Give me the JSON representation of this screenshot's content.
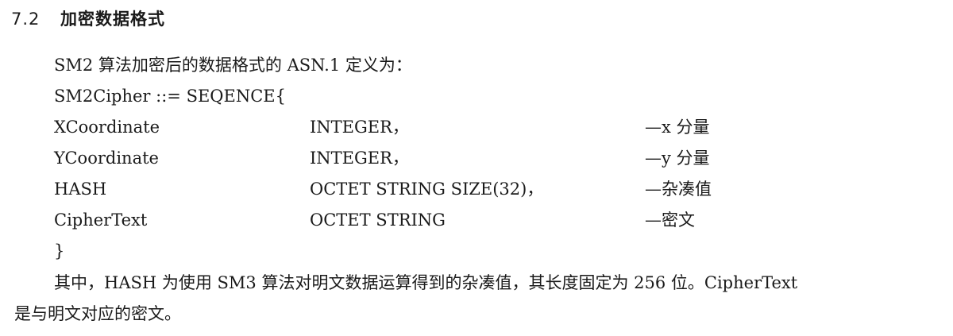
{
  "section": {
    "number": "7.2",
    "title": "加密数据格式"
  },
  "intro": "SM2 算法加密后的数据格式的 ASN.1 定义为：",
  "struct_open": "SM2Cipher ::= SEQENCE{",
  "fields": [
    {
      "name": "XCoordinate",
      "type": "INTEGER，",
      "comment": "—x 分量"
    },
    {
      "name": "YCoordinate",
      "type": "INTEGER，",
      "comment": "—y 分量"
    },
    {
      "name": "HASH",
      "type": "OCTET STRING SIZE(32)，",
      "comment": "—杂凑值"
    },
    {
      "name": "CipherText",
      "type": "OCTET STRING",
      "comment": "—密文"
    }
  ],
  "struct_close": "}",
  "paragraph": {
    "line1": "其中，HASH 为使用 SM3 算法对明文数据运算得到的杂凑值，其长度固定为 256 位。CipherText",
    "line2": "是与明文对应的密文。"
  }
}
